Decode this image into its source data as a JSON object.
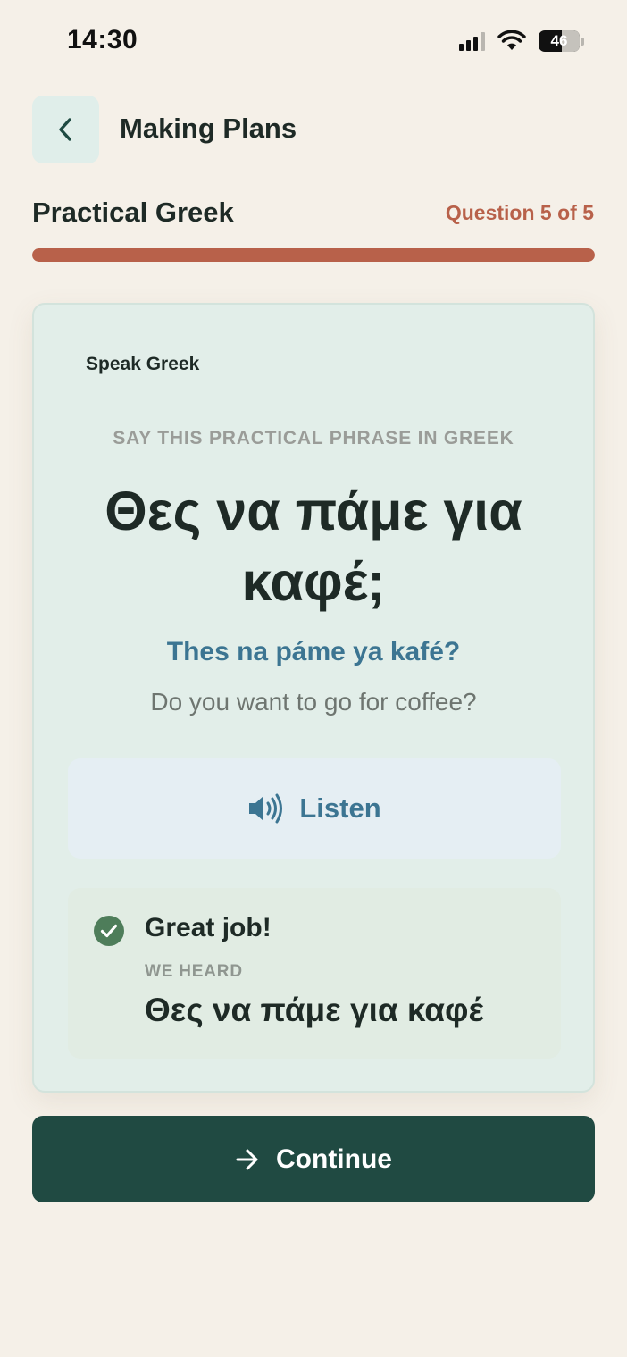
{
  "status_bar": {
    "time": "14:30",
    "battery": "46",
    "battery_level": 0.46
  },
  "header": {
    "title": "Making Plans"
  },
  "quiz": {
    "course": "Practical Greek",
    "counter": "Question 5 of 5",
    "progress": 1.0
  },
  "card": {
    "label": "Speak Greek",
    "instruction": "SAY THIS PRACTICAL PHRASE IN GREEK",
    "phrase": "Θες να πάμε για καφέ;",
    "transliteration": "Thes na páme ya kafé?",
    "translation": "Do you want to go for coffee?",
    "listen_label": "Listen",
    "result": {
      "title": "Great job!",
      "heard_label": "WE HEARD",
      "heard_text": "Θες να πάμε για καφέ"
    }
  },
  "footer": {
    "continue_label": "Continue"
  },
  "colors": {
    "accent": "#B8614A",
    "primary": "#204A42",
    "link": "#3C7592",
    "success": "#4E7D5A",
    "background": "#F5F0E8"
  },
  "icons": {
    "back": "chevron-left-icon",
    "listen": "speaker-icon",
    "result": "check-circle-icon",
    "continue": "arrow-right-icon"
  }
}
